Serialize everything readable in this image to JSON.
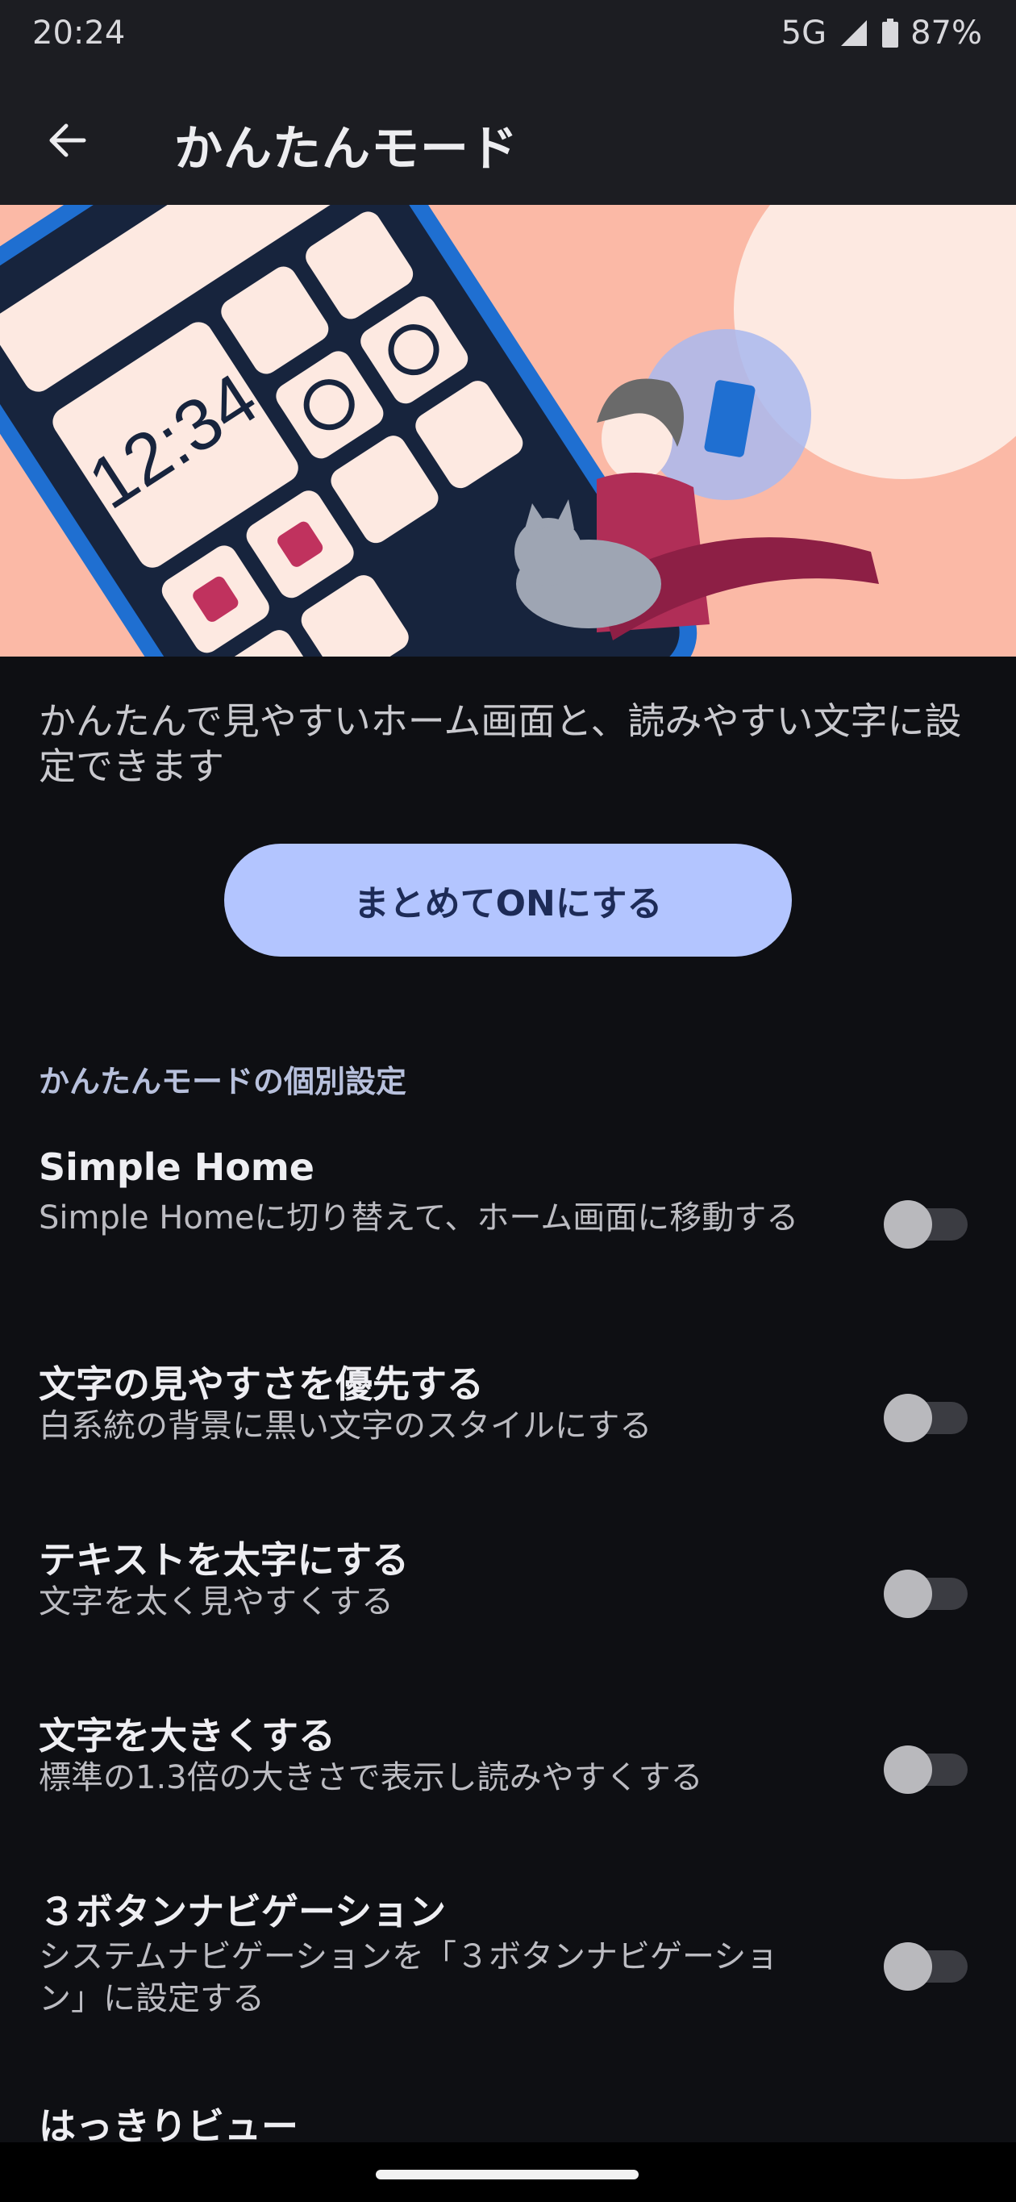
{
  "status_bar": {
    "time": "20:24",
    "network": "5G",
    "battery": "87%",
    "icons": [
      "signal-icon",
      "battery-icon"
    ]
  },
  "app_bar": {
    "title": "かんたんモード",
    "back_icon": "arrow-left-icon"
  },
  "hero": {
    "clock_text": "12:34"
  },
  "description": "かんたんで見やすいホーム画面と、読みやすい文字に設定できます",
  "primary_button": "まとめてONにする",
  "section_header": "かんたんモードの個別設定",
  "settings": [
    {
      "title": "Simple Home",
      "subtitle": "Simple Homeに切り替えて、ホーム画面に移動する",
      "enabled": false
    },
    {
      "title": "文字の見やすさを優先する",
      "subtitle": "白系統の背景に黒い文字のスタイルにする",
      "enabled": false
    },
    {
      "title": "テキストを太字にする",
      "subtitle": "文字を太く見やすくする",
      "enabled": false
    },
    {
      "title": "文字を大きくする",
      "subtitle": "標準の1.3倍の大きさで表示し読みやすくする",
      "enabled": false
    },
    {
      "title": "３ボタンナビゲーション",
      "subtitle": "システムナビゲーションを「３ボタンナビゲーション」に設定する",
      "enabled": false
    },
    {
      "title": "はっきりビュー",
      "subtitle": "",
      "enabled": false
    }
  ],
  "colors": {
    "background": "#0e0f13",
    "app_bar": "#1c1d22",
    "accent_button": "#b3c5ff",
    "hero_bg": "#fbb9a6",
    "phone_blue": "#1f6fd1"
  }
}
